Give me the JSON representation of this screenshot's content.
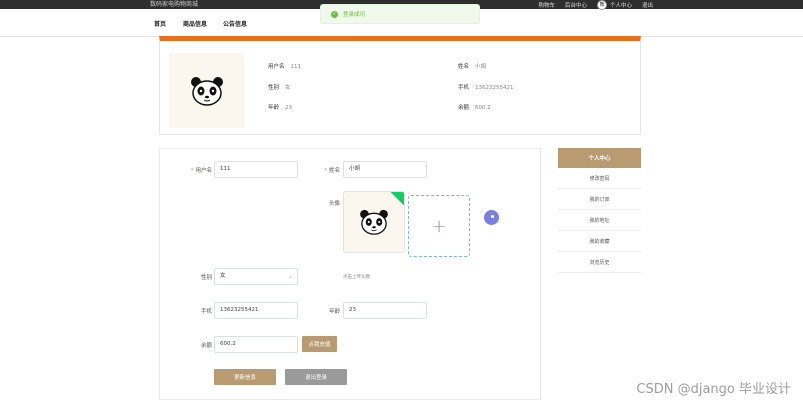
{
  "topbar": {
    "site_title": "数码家电购物商城",
    "links": [
      "购物车",
      "后台中心"
    ],
    "avatar_text": "熊",
    "user_center": "个人中心",
    "logout": "退出"
  },
  "toast": {
    "message": "登录成功",
    "icon": "check-circle-icon",
    "color": "#67c23a"
  },
  "nav": {
    "items": [
      "首页",
      "商品信息",
      "公告信息"
    ]
  },
  "profile": {
    "fields": [
      {
        "label": "用户名",
        "value": "111"
      },
      {
        "label": "性别",
        "value": "女"
      },
      {
        "label": "年龄",
        "value": "23"
      },
      {
        "label": "姓名",
        "value": "小胡"
      },
      {
        "label": "手机",
        "value": "13623255421"
      },
      {
        "label": "余额",
        "value": "600.2"
      }
    ],
    "accent": "#e8701a"
  },
  "form": {
    "username": {
      "label": "用户名",
      "value": "111"
    },
    "name": {
      "label": "姓名",
      "value": "小胡"
    },
    "avatar": {
      "label": "头像",
      "hint": "点击上传头像"
    },
    "gender": {
      "label": "性别",
      "value": "女"
    },
    "phone": {
      "label": "手机",
      "value": "13623255421"
    },
    "age": {
      "label": "年龄",
      "value": "23"
    },
    "balance": {
      "label": "余额",
      "value": "600.2",
      "recharge_label": "点我充值"
    },
    "update_label": "更新信息",
    "logout_label": "退出登录"
  },
  "sidebar": {
    "title": "个人中心",
    "items": [
      "修改密码",
      "我的订单",
      "我的地址",
      "我的收藏",
      "浏览历史"
    ],
    "accent": "#b99b71"
  },
  "watermark": "CSDN @django   毕业设计"
}
